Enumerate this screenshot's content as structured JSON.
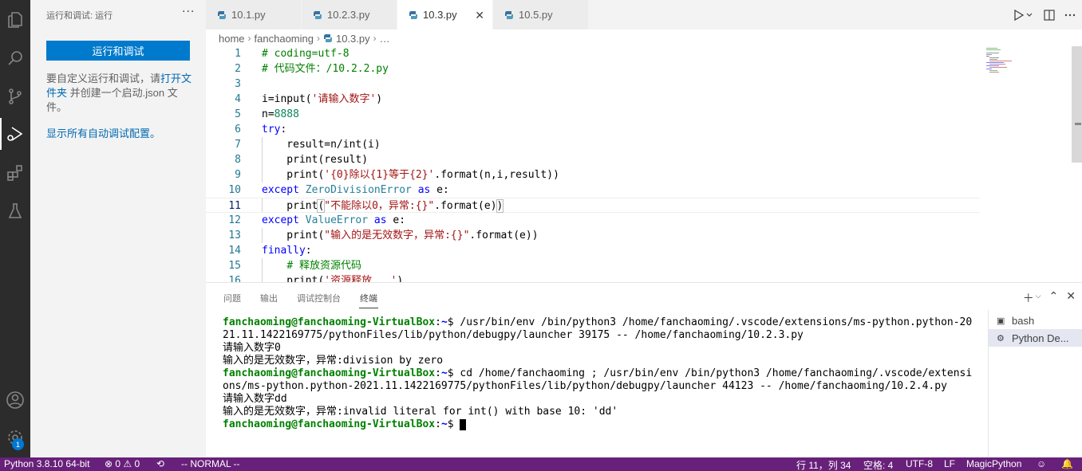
{
  "sidebar": {
    "title": "运行和调试: 运行",
    "more": "···",
    "run_button": "运行和调试",
    "text_pre": "要自定义运行和调试，请",
    "link_open_folder": "打开文件夹",
    "text_post": " 并创建一个启动.json 文件。",
    "show_all": "显示所有自动调试配置。"
  },
  "tabs": [
    {
      "label": "10.1.py"
    },
    {
      "label": "10.2.3.py"
    },
    {
      "label": "10.3.py",
      "close": "✕"
    },
    {
      "label": "10.5.py"
    }
  ],
  "breadcrumb": {
    "home": "home",
    "folder": "fanchaoming",
    "file": "10.3.py",
    "more": "…"
  },
  "editor": {
    "line_numbers": [
      "1",
      "2",
      "3",
      "4",
      "5",
      "6",
      "7",
      "8",
      "9",
      "10",
      "11",
      "12",
      "13",
      "14",
      "15",
      "16"
    ],
    "current_line": 11
  },
  "panel": {
    "tabs": [
      "问题",
      "输出",
      "调试控制台",
      "终端"
    ],
    "terminal_list": [
      {
        "label": "bash"
      },
      {
        "label": "Python De..."
      }
    ],
    "terminal": {
      "user": "fanchaoming@fanchaoming-VirtualBox",
      "path": "~",
      "prompt": "$",
      "cmd1": " /usr/bin/env /bin/python3 /home/fanchaoming/.vscode/extensions/ms-python.python-2021.11.1422169775/pythonFiles/lib/python/debugpy/launcher 39175 -- /home/fanchaoming/10.2.3.py",
      "out1": "请输入数字0",
      "out2": "输入的是无效数字，异常:division by zero",
      "cmd2": " cd /home/fanchaoming ; /usr/bin/env /bin/python3 /home/fanchaoming/.vscode/extensions/ms-python.python-2021.11.1422169775/pythonFiles/lib/python/debugpy/launcher 44123 -- /home/fanchaoming/10.2.4.py",
      "out3": "请输入数字dd",
      "out4": "输入的是无效数字，异常:invalid literal for int() with base 10: 'dd'"
    }
  },
  "status": {
    "python": "Python 3.8.10 64-bit",
    "problems": "⊗ 0 ⚠ 0",
    "mode": "-- NORMAL --",
    "position": "行 11，列 34",
    "spaces": "空格: 4",
    "encoding": "UTF-8",
    "eol": "LF",
    "language": "MagicPython"
  },
  "badge": "1",
  "colors": {
    "status_bar": "#68217a",
    "accent": "#007acc",
    "activity_bar": "#2c2c2c"
  }
}
